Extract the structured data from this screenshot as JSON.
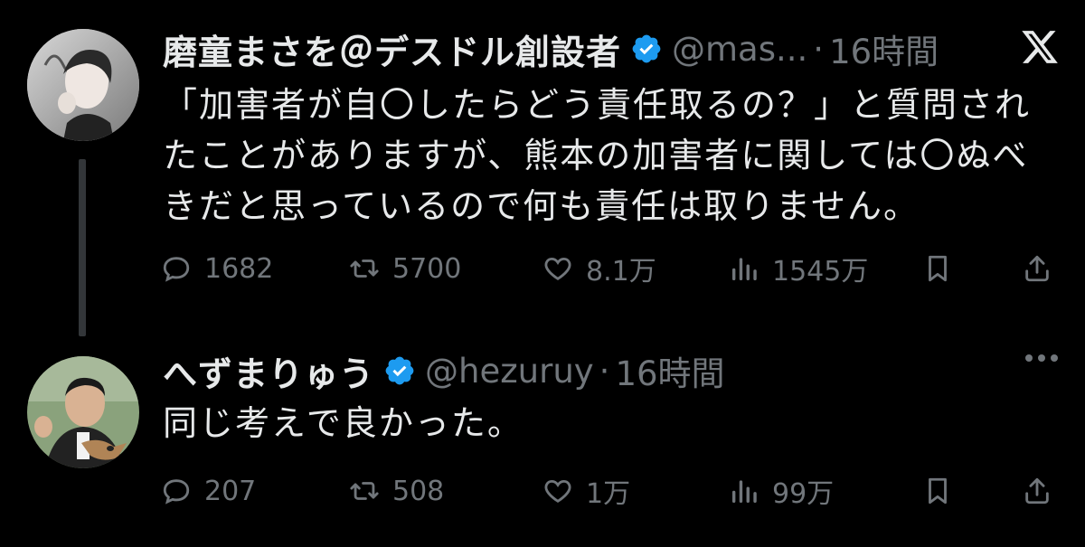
{
  "tweets": [
    {
      "name": "磨童まさを＠デスドル創設者",
      "handle": "@mas...",
      "separator": "·",
      "time": "16時間",
      "text_lines": [
        "「加害者が自〇したらどう責任取るの？」と質問され",
        "たことがありますが、熊本の加害者に関しては〇ぬべ",
        "きだと思っているので何も責任は取りません。"
      ],
      "replies": "1682",
      "retweets": "5700",
      "likes": "8.1万",
      "views": "1545万"
    },
    {
      "name": "へずまりゅう",
      "handle": "@hezuruy",
      "separator": "·",
      "time": "16時間",
      "text_lines": [
        "同じ考えで良かった。"
      ],
      "replies": "207",
      "retweets": "508",
      "likes": "1万",
      "views": "99万"
    }
  ],
  "icons": {
    "verified": "verified-badge-icon",
    "x_logo": "x-logo-icon",
    "reply": "reply-icon",
    "retweet": "retweet-icon",
    "like": "heart-icon",
    "views": "views-icon",
    "bookmark": "bookmark-icon",
    "share": "share-icon",
    "more": "more-icon"
  },
  "colors": {
    "background": "#000000",
    "text": "#e7e9ea",
    "muted": "#71767b",
    "verified": "#1d9bf0"
  }
}
